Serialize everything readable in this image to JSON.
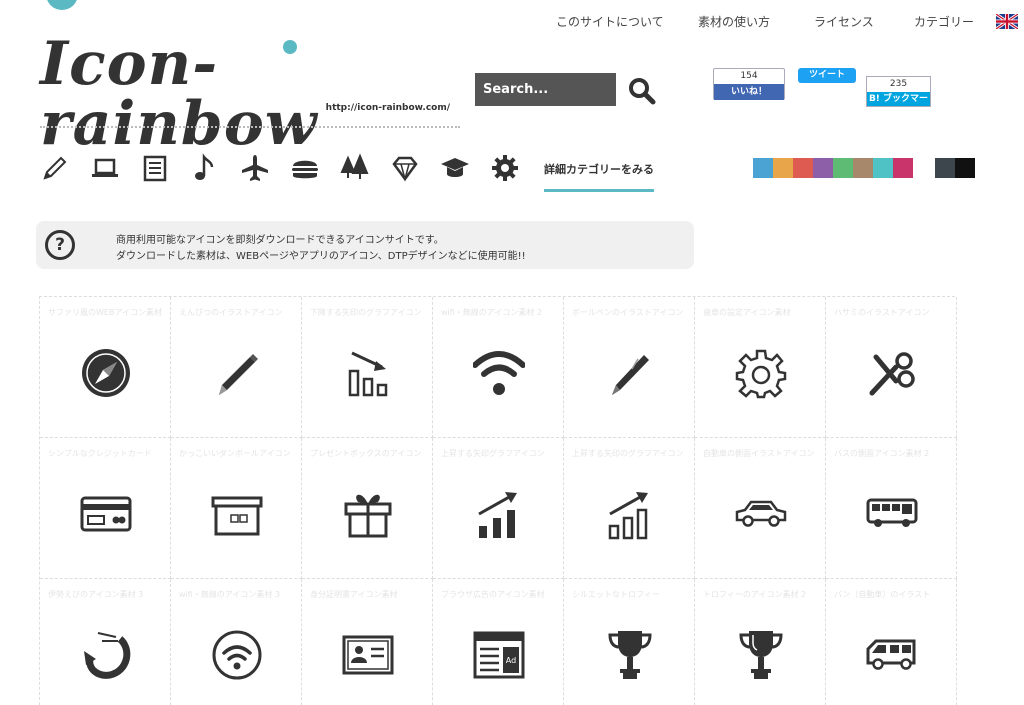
{
  "nav": {
    "items": [
      "このサイトについて",
      "素材の使い方",
      "ライセンス",
      "カテゴリー"
    ]
  },
  "logo": {
    "text": "Icon-rainbow",
    "url": "http://icon-rainbow.com/"
  },
  "search": {
    "label": "Search..."
  },
  "social": {
    "fb_count": "154",
    "fb_label": "いいね！",
    "tweet_label": "ツイート",
    "hatena_count": "235",
    "hatena_label": "B! ブックマーク"
  },
  "categories": {
    "icons": [
      "pencil-icon",
      "laptop-icon",
      "newspaper-icon",
      "music-note-icon",
      "airplane-icon",
      "hamburger-icon",
      "trees-icon",
      "diamond-icon",
      "graduation-cap-icon",
      "gear-icon"
    ],
    "more_label": "詳細カテゴリーをみる"
  },
  "colors": [
    "#4ba3d3",
    "#e9a549",
    "#de5b52",
    "#8c5fa8",
    "#5dbb74",
    "#a8886a",
    "#4ec2c5",
    "#c9356b",
    "#3d454d",
    "#111111"
  ],
  "accent": "#5bb9c4",
  "notice": {
    "line1": "商用利用可能なアイコンを即刻ダウンロードできるアイコンサイトです。",
    "line2": "ダウンロードした素材は、WEBページやアプリのアイコン、DTPデザインなどに使用可能!!"
  },
  "grid": {
    "items": [
      {
        "title": "サファリ風のWEBアイコン素材",
        "icon": "compass-icon"
      },
      {
        "title": "えんぴつのイラストアイコン",
        "icon": "pencil-icon"
      },
      {
        "title": "下降する矢印のグラフアイコン",
        "icon": "falling-chart-icon"
      },
      {
        "title": "wifi・無線のアイコン素材 2",
        "icon": "wifi-icon"
      },
      {
        "title": "ボールペンのイラストアイコン",
        "icon": "pen-icon"
      },
      {
        "title": "歯車の設定アイコン素材",
        "icon": "gear-icon"
      },
      {
        "title": "ハサミのイラストアイコン",
        "icon": "scissors-icon"
      },
      {
        "title": "シンプルなクレジットカード",
        "icon": "credit-card-icon"
      },
      {
        "title": "かっこいいダンボールアイコン",
        "icon": "box-icon"
      },
      {
        "title": "プレゼントボックスのアイコン",
        "icon": "gift-icon"
      },
      {
        "title": "上昇する矢印グラフアイコン",
        "icon": "rising-chart-icon"
      },
      {
        "title": "上昇する矢印のグラフアイコン",
        "icon": "rising-chart-outline-icon"
      },
      {
        "title": "自動車の側面イラストアイコン",
        "icon": "car-icon"
      },
      {
        "title": "バスの側面アイコン素材 2",
        "icon": "bus-icon"
      },
      {
        "title": "伊勢えびのアイコン素材 3",
        "icon": "shrimp-icon"
      },
      {
        "title": "wifi・無線のアイコン素材 3",
        "icon": "wifi-circle-icon"
      },
      {
        "title": "身分証明書アイコン素材",
        "icon": "id-card-icon"
      },
      {
        "title": "ブラウザ広告のアイコン素材",
        "icon": "browser-ad-icon"
      },
      {
        "title": "シルエットなトロフィー",
        "icon": "trophy-icon"
      },
      {
        "title": "トロフィーのアイコン素材 2",
        "icon": "trophy-icon-2"
      },
      {
        "title": "バン（自動車）のイラスト",
        "icon": "van-icon"
      }
    ]
  }
}
